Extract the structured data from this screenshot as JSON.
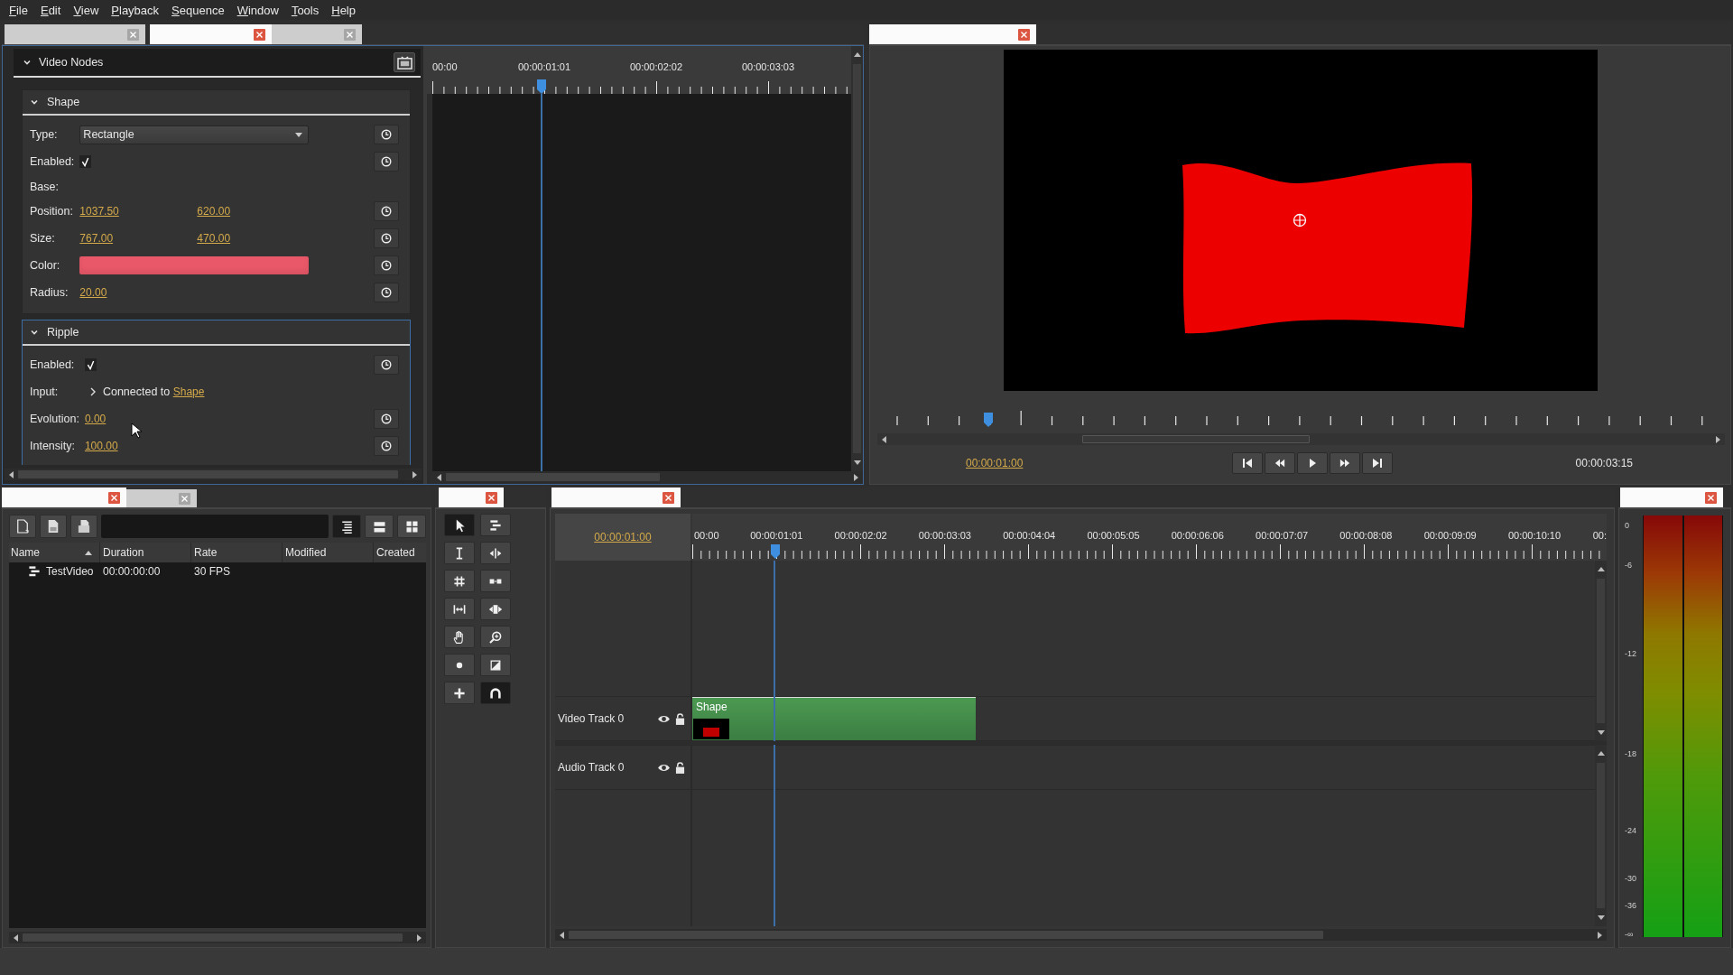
{
  "menu": [
    "File",
    "Edit",
    "View",
    "Playback",
    "Sequence",
    "Window",
    "Tools",
    "Help"
  ],
  "param_panel": {
    "tabs": [
      {
        "selected": false
      },
      {
        "selected": true
      },
      {
        "selected": false
      }
    ],
    "title": "Video Nodes",
    "nodes": [
      {
        "name": "Shape",
        "expanded": true,
        "selected": false,
        "params": [
          {
            "kind": "dropdown",
            "label": "Type:",
            "value": "Rectangle",
            "keyframe": true
          },
          {
            "kind": "checkbox",
            "label": "Enabled:",
            "checked": true,
            "keyframe": true
          },
          {
            "kind": "heading",
            "label": "Base:",
            "keyframe": false
          },
          {
            "kind": "number",
            "label": "Position:",
            "values": [
              "1037.50",
              "620.00"
            ],
            "keyframe": true
          },
          {
            "kind": "number",
            "label": "Size:",
            "values": [
              "767.00",
              "470.00"
            ],
            "keyframe": true
          },
          {
            "kind": "color",
            "label": "Color:",
            "color": "#e95869",
            "keyframe": true
          },
          {
            "kind": "number",
            "label": "Radius:",
            "values": [
              "20.00"
            ],
            "keyframe": true
          }
        ]
      },
      {
        "name": "Ripple",
        "expanded": true,
        "selected": true,
        "params": [
          {
            "kind": "checkbox",
            "label": "Enabled:",
            "checked": true,
            "keyframe": true
          },
          {
            "kind": "input",
            "label": "Input:",
            "expanded": false,
            "text": "Connected to",
            "link": "Shape",
            "keyframe": false
          },
          {
            "kind": "number",
            "label": "Evolution:",
            "values": [
              "0.00"
            ],
            "keyframe": true
          },
          {
            "kind": "number",
            "label": "Intensity:",
            "values": [
              "100.00"
            ],
            "keyframe": true
          }
        ]
      }
    ]
  },
  "keyframe_view": {
    "ruler": [
      "00:00",
      "00:00:01:01",
      "00:00:02:02",
      "00:00:03:03"
    ],
    "playhead": {
      "level": 0.26
    }
  },
  "viewer": {
    "tabs": [
      {
        "selected": true
      }
    ],
    "playhead": {
      "level": 0.13
    },
    "current_time": "00:00:01:00",
    "end_time": "00:00:03:15"
  },
  "media_panel": {
    "tabs": [
      {
        "selected": true
      },
      {
        "selected": false
      }
    ],
    "view_buttons": [
      {
        "kind": "tree",
        "selected": true
      },
      {
        "kind": "list",
        "selected": false
      },
      {
        "kind": "icons",
        "selected": false
      }
    ],
    "columns": [
      {
        "label": "Name",
        "sorted": true
      },
      {
        "label": "Duration",
        "sorted": false
      },
      {
        "label": "Rate",
        "sorted": false
      },
      {
        "label": "Modified",
        "sorted": false
      },
      {
        "label": "Created",
        "sorted": false
      }
    ],
    "rows": [
      {
        "kind": "sequence",
        "cells": [
          "TestVideo",
          "00:00:00:00",
          "30 FPS"
        ]
      }
    ]
  },
  "tools_panel": {
    "tabs": [
      {
        "selected": true
      }
    ],
    "tools": [
      {
        "kind": "pointer",
        "selected": true
      },
      {
        "kind": "track_select",
        "selected": false
      },
      {
        "kind": "edit",
        "selected": false
      },
      {
        "kind": "ripple",
        "selected": false
      },
      {
        "kind": "rolling",
        "selected": false
      },
      {
        "kind": "razor",
        "selected": false
      },
      {
        "kind": "slide",
        "selected": false
      },
      {
        "kind": "slip",
        "selected": false
      },
      {
        "kind": "hand",
        "selected": false
      },
      {
        "kind": "zoom",
        "selected": false
      },
      {
        "kind": "record",
        "selected": false
      },
      {
        "kind": "transition",
        "selected": false
      },
      {
        "kind": "add",
        "selected": false
      },
      {
        "kind": "snapping",
        "selected": true
      }
    ]
  },
  "timeline": {
    "tabs": [
      {
        "selected": true
      }
    ],
    "current_time": "00:00:01:00",
    "ruler": [
      "00:00",
      "00:00:01:01",
      "00:00:02:02",
      "00:00:03:03",
      "00:00:04:04",
      "00:00:05:05",
      "00:00:06:06",
      "00:00:07:07",
      "00:00:08:08",
      "00:00:09:09",
      "00:00:10:10",
      "00:"
    ],
    "playhead": {
      "level": 0.091
    },
    "tracks": [
      {
        "kind": "video",
        "name": "Video Track 0",
        "visible": true,
        "locked": false,
        "clips": [
          {
            "name": "Shape",
            "level": 0.314
          }
        ]
      },
      {
        "kind": "audio",
        "name": "Audio Track 0",
        "visible": true,
        "locked": false
      }
    ]
  },
  "audio_meter": {
    "tabs": [
      {
        "selected": true
      }
    ],
    "scale": [
      "0",
      "-6",
      "-12",
      "-18",
      "-24",
      "-30",
      "-36",
      "-∞"
    ]
  }
}
